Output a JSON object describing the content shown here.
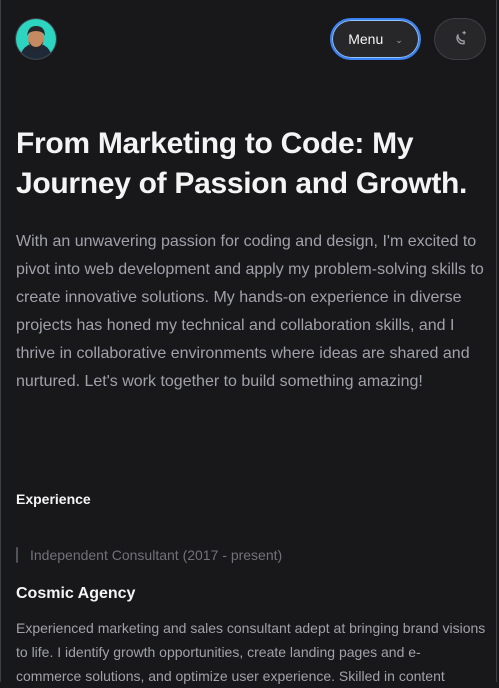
{
  "header": {
    "menu_label": "Menu",
    "menu_chevron": "chevron-down-icon",
    "theme_toggle_icon": "moon-sparkle-icon",
    "avatar_icon": "avatar-icon"
  },
  "hero": {
    "title": "From Marketing to Code: My Journey of Passion and Growth.",
    "intro": "With an unwavering passion for coding and design, I'm excited to pivot into web development and apply my problem-solving skills to create innovative solutions. My hands-on experience in diverse projects has honed my technical and collaboration skills, and I thrive in collaborative environments where ideas are shared and nurtured. Let's work together to build something amazing!"
  },
  "experience": {
    "section_title": "Experience",
    "items": [
      {
        "role": "Independent Consultant (2017 - present)",
        "company": "Cosmic Agency",
        "description": "Experienced marketing and sales consultant adept at bringing brand visions to life. I identify growth opportunities, create landing pages and e-commerce solutions, and optimize user experience. Skilled in content"
      }
    ]
  },
  "colors": {
    "background": "#18181b",
    "accent_ring": "#3b82f6",
    "muted_text": "#a1a1aa"
  }
}
